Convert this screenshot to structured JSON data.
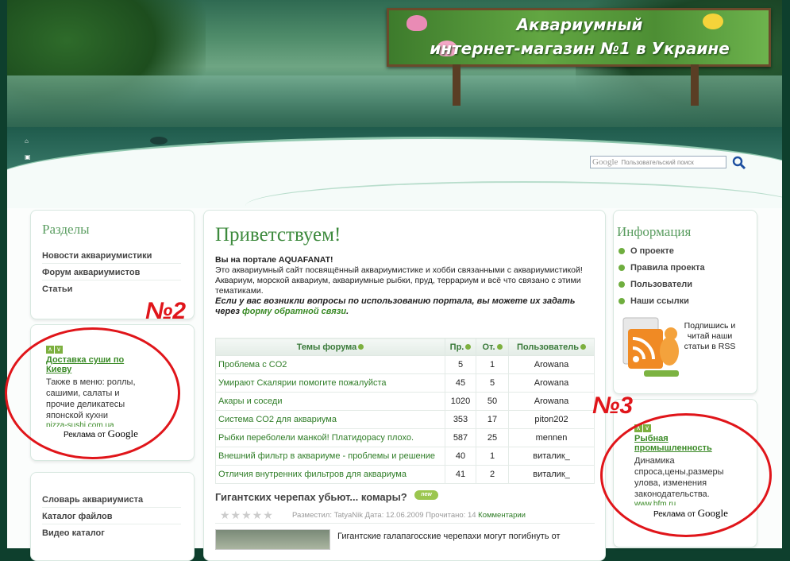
{
  "header": {
    "sign_line1": "Аквариумный",
    "sign_line2": "интернет-магазин №1 в Украине",
    "search_placeholder": "Пользовательский поиск",
    "search_google": "Google"
  },
  "left": {
    "sections_title": "Разделы",
    "sections": [
      "Новости аквариумистики",
      "Форум аквариумистов",
      "Статьи"
    ],
    "ad": {
      "link": "Доставка суши по Киеву",
      "text": "Также в меню: роллы, сашими, салаты и прочие деликатесы японской кухни",
      "url": "pizza-sushi.com.ua",
      "label": "Реклама от",
      "google": "Google"
    },
    "annotation": "№2",
    "bottom_links": [
      "Словарь аквариумиста",
      "Каталог файлов",
      "Видео каталог"
    ]
  },
  "main": {
    "welcome": "Приветствуем!",
    "portal": "Вы на портале AQUAFANAT!",
    "intro": "Это аквариумный сайт посвящённый аквариумистике и хобби связанными с аквариумистикой! Аквариум, морской аквариум, аквариумные рыбки, пруд, террариум и всё что связано с этими тематиками.",
    "question": "Если у вас возникли вопросы по использованию портала, вы можете их задать через",
    "feedback_link": "форму обратной связи",
    "question_end": ".",
    "forum": {
      "headers": [
        "Темы форума",
        "Пр.",
        "От.",
        "Пользователь"
      ],
      "rows": [
        [
          "Проблема с CO2",
          "5",
          "1",
          "Arowana"
        ],
        [
          "Умирают Скалярии помогите пожалуйста",
          "45",
          "5",
          "Arowana"
        ],
        [
          "Акары и соседи",
          "1020",
          "50",
          "Arowana"
        ],
        [
          "Система CO2 для аквариума",
          "353",
          "17",
          "piton202"
        ],
        [
          "Рыбки переболели манкой! Платидорасу плохо.",
          "587",
          "25",
          "mennen"
        ],
        [
          "Внешний фильтр в аквариуме - проблемы и решение",
          "40",
          "1",
          "виталик_"
        ],
        [
          "Отличия внутренних фильтров для аквариума",
          "41",
          "2",
          "виталик_"
        ]
      ]
    },
    "article_title": "Гигантских черепах убьют... комары?",
    "new_badge": "new",
    "meta_prefix": "Разместил: TatyaNik Дата: 12.06.2009 Прочитано: 14",
    "meta_comments": "Комментарии",
    "article_text": "Гигантские галапагосские черепахи могут погибнуть от"
  },
  "right": {
    "info_title": "Информация",
    "links": [
      "О проекте",
      "Правила проекта",
      "Пользователи",
      "Наши ссылки"
    ],
    "rss_text": "Подпишись и читай наши статьи в RSS",
    "annotation": "№3",
    "ad": {
      "link": "Рыбная промышленность",
      "text": "Динамика спроса,цены,размеры улова, изменения законодательства.",
      "url": "www.bfm.ru",
      "label": "Реклама от",
      "google": "Google"
    }
  }
}
